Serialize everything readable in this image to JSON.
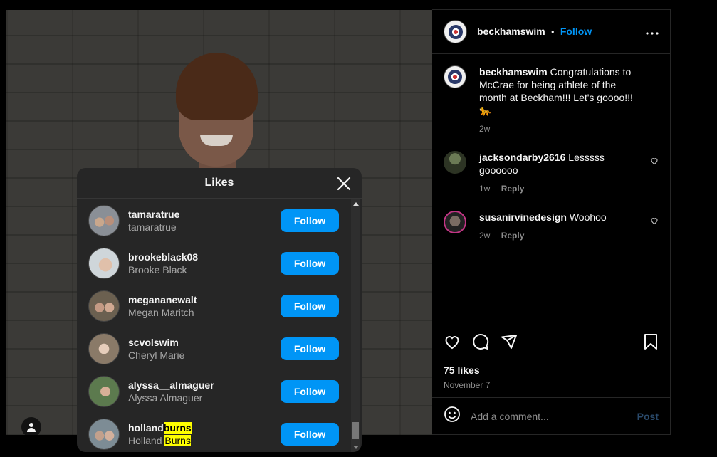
{
  "post": {
    "username": "beckhamswim",
    "separator": "•",
    "follow_label": "Follow",
    "more_icon": "more-horizontal-icon",
    "caption_user": "beckhamswim",
    "caption_text": "Congratulations to McCrae for being athlete of the month at Beckham!!! Let's goooo!!! 🐆",
    "caption_age": "2w",
    "likes": "75 likes",
    "date": "November 7",
    "add_comment_placeholder": "Add a comment...",
    "post_label": "Post"
  },
  "comments": [
    {
      "user": "jacksondarby2616",
      "text": "Lesssss goooooo",
      "age": "1w",
      "reply": "Reply"
    },
    {
      "user": "susanirvinedesign",
      "text": "Woohoo",
      "age": "2w",
      "reply": "Reply"
    }
  ],
  "likes_modal": {
    "title": "Likes",
    "users": [
      {
        "username": "tamaratrue",
        "fullname": "tamaratrue",
        "button": "Follow"
      },
      {
        "username": "brookeblack08",
        "fullname": "Brooke Black",
        "button": "Follow"
      },
      {
        "username": "megananewalt",
        "fullname": "Megan Maritch",
        "button": "Follow"
      },
      {
        "username": "scvolswim",
        "fullname": "Cheryl Marie",
        "button": "Follow"
      },
      {
        "username": "alyssa__almaguer",
        "fullname": "Alyssa Almaguer",
        "button": "Follow"
      },
      {
        "username_pre": "holland",
        "username_hl": "burns",
        "fullname_pre": "Holland ",
        "fullname_hl": "Burns",
        "button": "Follow"
      }
    ]
  },
  "colors": {
    "accent": "#0095f6",
    "highlight": "#ffff00",
    "modal_bg": "#262626"
  }
}
